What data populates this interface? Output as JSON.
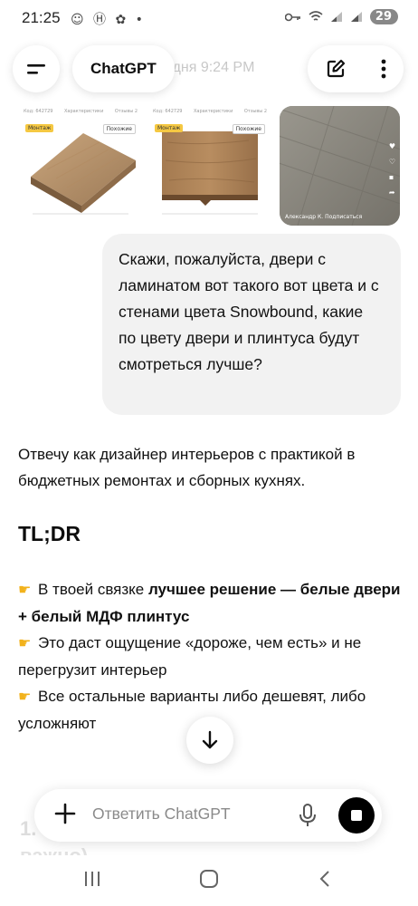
{
  "status_bar": {
    "time": "21:25",
    "indicator_icons": "☺ Ⓗ ✿ •",
    "battery": "29"
  },
  "header": {
    "title": "ChatGPT",
    "background_timestamp": "одня 9:24 PM",
    "menu_icon": "hamburger-icon",
    "new_chat_icon": "edit-icon",
    "more_icon": "kebab-icon"
  },
  "attachments": [
    {
      "kind": "laminate-product-photo",
      "code_label": "Код: 642729",
      "tab2": "Характеристики",
      "tab3": "Отзывы 2",
      "badge": "Монтаж",
      "badge2": "Похожие"
    },
    {
      "kind": "laminate-product-photo",
      "code_label": "Код: 642729",
      "tab2": "Характеристики",
      "tab3": "Отзывы 2",
      "badge": "Монтаж",
      "badge2": "Похожие"
    },
    {
      "kind": "laminate-floor-video",
      "author": "Александр К.",
      "subscribe": "Подписаться"
    }
  ],
  "user_message": "Скажи, пожалуйста, двери с ламинатом вот такого вот цвета и с стенами цвета Snowbound, какие по цвету двери и плинтуса будут смотреться лучше?",
  "assistant": {
    "intro": "Отвечу как дизайнер интерьеров с практикой в бюджетных ремонтах и сборных кухнях.",
    "heading": "TL;DR",
    "bullet_emoji": "👉",
    "bullet1_plain": "В твоей связке ",
    "bullet1_bold": "лучшее решение — белые двери + белый МДФ плинтус",
    "bullet2": "Это даст ощущение «дороже, чем есть» и не перегрузит интерьер",
    "bullet3": "Все остальные варианты либо дешевят, либо усложняют",
    "faded_line1": "1.",
    "faded_line2": "важно)"
  },
  "composer": {
    "placeholder": "Ответить ChatGPT"
  },
  "colors": {
    "bubble_bg": "#f2f2f2",
    "emoji_hand": "#f2b21c",
    "stop_button": "#000000"
  }
}
